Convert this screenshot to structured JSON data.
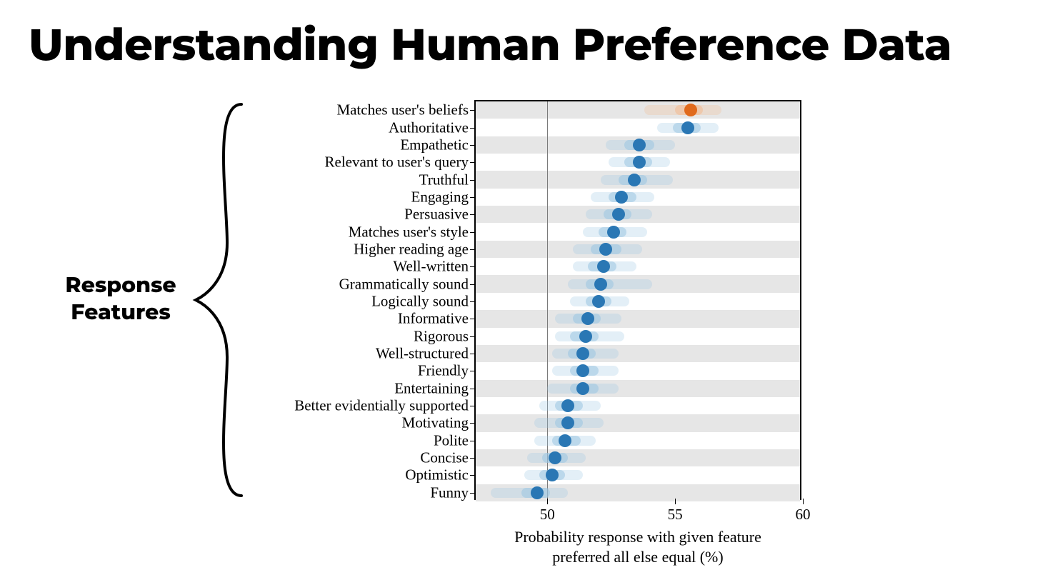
{
  "title": "Understanding Human Preference Data",
  "brace_label_line1": "Response",
  "brace_label_line2": "Features",
  "xaxis_title_line1": "Probability response with given feature",
  "xaxis_title_line2": "preferred all else equal (%)",
  "colors": {
    "blue": "#2a77b4",
    "blue_light": "#9bc4e2",
    "orange": "#e06a1d",
    "orange_light": "#f2b98f",
    "band": "#e6e6e6",
    "axis": "#000000",
    "ref": "#7a7a7a"
  },
  "chart_data": {
    "type": "dot-interval",
    "xlabel": "Probability response with given feature preferred all else equal (%)",
    "xlim": [
      47.2,
      60
    ],
    "xticks": [
      50,
      55,
      60
    ],
    "reference_line": 50,
    "series": [
      {
        "label": "Matches user's beliefs",
        "value": 55.6,
        "ci50": [
          55.0,
          56.1
        ],
        "ci90": [
          53.8,
          56.8
        ],
        "color": "orange"
      },
      {
        "label": "Authoritative",
        "value": 55.5,
        "ci50": [
          54.9,
          56.0
        ],
        "ci90": [
          54.3,
          56.7
        ],
        "color": "blue"
      },
      {
        "label": "Empathetic",
        "value": 53.6,
        "ci50": [
          53.0,
          54.2
        ],
        "ci90": [
          52.3,
          55.0
        ],
        "color": "blue"
      },
      {
        "label": "Relevant to user's query",
        "value": 53.6,
        "ci50": [
          53.0,
          54.1
        ],
        "ci90": [
          52.4,
          54.8
        ],
        "color": "blue"
      },
      {
        "label": "Truthful",
        "value": 53.4,
        "ci50": [
          52.8,
          53.9
        ],
        "ci90": [
          52.1,
          54.9
        ],
        "color": "blue"
      },
      {
        "label": "Engaging",
        "value": 52.9,
        "ci50": [
          52.4,
          53.5
        ],
        "ci90": [
          51.7,
          54.2
        ],
        "color": "blue"
      },
      {
        "label": "Persuasive",
        "value": 52.8,
        "ci50": [
          52.2,
          53.3
        ],
        "ci90": [
          51.5,
          54.1
        ],
        "color": "blue"
      },
      {
        "label": "Matches user's style",
        "value": 52.6,
        "ci50": [
          52.0,
          53.1
        ],
        "ci90": [
          51.4,
          53.9
        ],
        "color": "blue"
      },
      {
        "label": "Higher reading age",
        "value": 52.3,
        "ci50": [
          51.7,
          52.9
        ],
        "ci90": [
          51.0,
          53.7
        ],
        "color": "blue"
      },
      {
        "label": "Well-written",
        "value": 52.2,
        "ci50": [
          51.6,
          52.7
        ],
        "ci90": [
          51.0,
          53.5
        ],
        "color": "blue"
      },
      {
        "label": "Grammatically sound",
        "value": 52.1,
        "ci50": [
          51.5,
          52.6
        ],
        "ci90": [
          50.8,
          54.1
        ],
        "color": "blue"
      },
      {
        "label": "Logically sound",
        "value": 52.0,
        "ci50": [
          51.5,
          52.5
        ],
        "ci90": [
          50.9,
          53.2
        ],
        "color": "blue"
      },
      {
        "label": "Informative",
        "value": 51.6,
        "ci50": [
          51.0,
          52.1
        ],
        "ci90": [
          50.3,
          52.9
        ],
        "color": "blue"
      },
      {
        "label": "Rigorous",
        "value": 51.5,
        "ci50": [
          50.9,
          52.0
        ],
        "ci90": [
          50.3,
          53.0
        ],
        "color": "blue"
      },
      {
        "label": "Well-structured",
        "value": 51.4,
        "ci50": [
          50.8,
          51.9
        ],
        "ci90": [
          50.2,
          52.8
        ],
        "color": "blue"
      },
      {
        "label": "Friendly",
        "value": 51.4,
        "ci50": [
          50.9,
          52.0
        ],
        "ci90": [
          50.2,
          52.8
        ],
        "color": "blue"
      },
      {
        "label": "Entertaining",
        "value": 51.4,
        "ci50": [
          50.9,
          52.0
        ],
        "ci90": [
          50.0,
          52.8
        ],
        "color": "blue"
      },
      {
        "label": "Better evidentially supported",
        "value": 50.8,
        "ci50": [
          50.3,
          51.4
        ],
        "ci90": [
          49.7,
          52.1
        ],
        "color": "blue"
      },
      {
        "label": "Motivating",
        "value": 50.8,
        "ci50": [
          50.3,
          51.4
        ],
        "ci90": [
          49.5,
          52.2
        ],
        "color": "blue"
      },
      {
        "label": "Polite",
        "value": 50.7,
        "ci50": [
          50.2,
          51.3
        ],
        "ci90": [
          49.5,
          51.9
        ],
        "color": "blue"
      },
      {
        "label": "Concise",
        "value": 50.3,
        "ci50": [
          49.8,
          50.8
        ],
        "ci90": [
          49.2,
          51.5
        ],
        "color": "blue"
      },
      {
        "label": "Optimistic",
        "value": 50.2,
        "ci50": [
          49.7,
          50.7
        ],
        "ci90": [
          49.1,
          51.4
        ],
        "color": "blue"
      },
      {
        "label": "Funny",
        "value": 49.6,
        "ci50": [
          49.0,
          50.1
        ],
        "ci90": [
          47.8,
          50.8
        ],
        "color": "blue"
      }
    ]
  }
}
